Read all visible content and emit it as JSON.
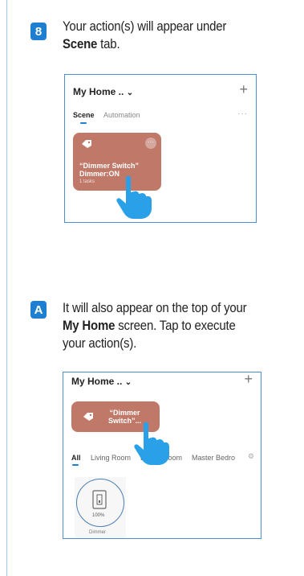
{
  "step8": {
    "badge": "8",
    "text_line1": "Your action(s) will appear under",
    "text_bold": "Scene",
    "text_rest": " tab.",
    "phone": {
      "title": "My Home ..",
      "chevron": "⌄",
      "plus": "+",
      "tabs": [
        {
          "label": "Scene",
          "active": true
        },
        {
          "label": "Automation",
          "active": false
        }
      ],
      "more": "···",
      "card": {
        "more": "···",
        "name_line1": "“Dimmer Switch”",
        "name_line2": "Dimmer:ON",
        "sub": "1 tasks"
      }
    }
  },
  "stepA": {
    "badge": "A",
    "text_line1": "It will also appear on the top of your",
    "text_bold": "My Home",
    "text_rest": " screen. Tap to execute",
    "text_line3": "your action(s).",
    "phone": {
      "title": "My Home ..",
      "chevron": "⌄",
      "plus": "+",
      "card": {
        "name_line1": "“Dimmer",
        "name_line2": "Switch”..."
      },
      "rooms": [
        {
          "label": "All",
          "active": true
        },
        {
          "label": "Living Room",
          "active": false
        },
        {
          "label": "Dining Room",
          "active": false
        },
        {
          "label": "Master Bedro",
          "active": false
        }
      ],
      "gear": "⚙",
      "device": {
        "percent": "100%",
        "name": "Dimmer"
      }
    }
  },
  "colors": {
    "accent": "#1e7fd0",
    "card": "#c07868",
    "hand": "#2aa0e8"
  }
}
